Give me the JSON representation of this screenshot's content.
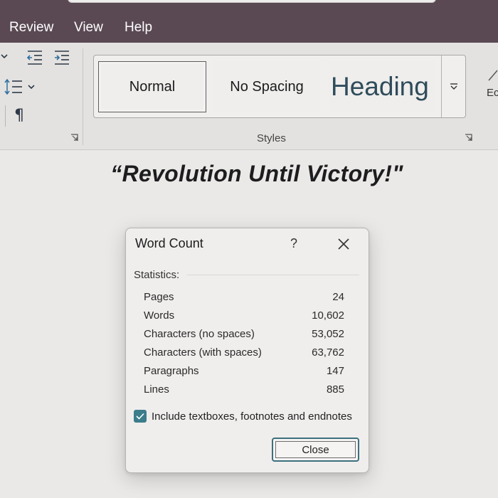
{
  "menu": {
    "tabs": [
      {
        "label": "Review"
      },
      {
        "label": "View"
      },
      {
        "label": "Help"
      }
    ]
  },
  "ribbon": {
    "styles": {
      "group_label": "Styles",
      "items": [
        {
          "label": "Normal",
          "selected": true
        },
        {
          "label": "No Spacing"
        },
        {
          "label": "Heading 1",
          "visible_label": "Heading"
        }
      ]
    },
    "icons": [
      "decrease-indent-icon",
      "increase-indent-icon",
      "line-spacing-icon",
      "show-formatting-marks-icon",
      "styles-gallery-more-icon",
      "dialog-launcher-icon"
    ]
  },
  "document": {
    "title": "“Revolution Until Victory!\""
  },
  "dialog": {
    "title": "Word Count",
    "help": "?",
    "statistics_label": "Statistics:",
    "stats": [
      {
        "label": "Pages",
        "value": "24"
      },
      {
        "label": "Words",
        "value": "10,602"
      },
      {
        "label": "Characters (no spaces)",
        "value": "53,052"
      },
      {
        "label": "Characters (with spaces)",
        "value": "63,762"
      },
      {
        "label": "Paragraphs",
        "value": "147"
      },
      {
        "label": "Lines",
        "value": "885"
      }
    ],
    "include_checkbox": {
      "label": "Include textboxes, footnotes and endnotes",
      "checked": true
    },
    "close_button": "Close"
  },
  "colors": {
    "title_bar": "#5a4953",
    "accent": "#3c7d8c",
    "heading_style": "#2f4c5a"
  }
}
